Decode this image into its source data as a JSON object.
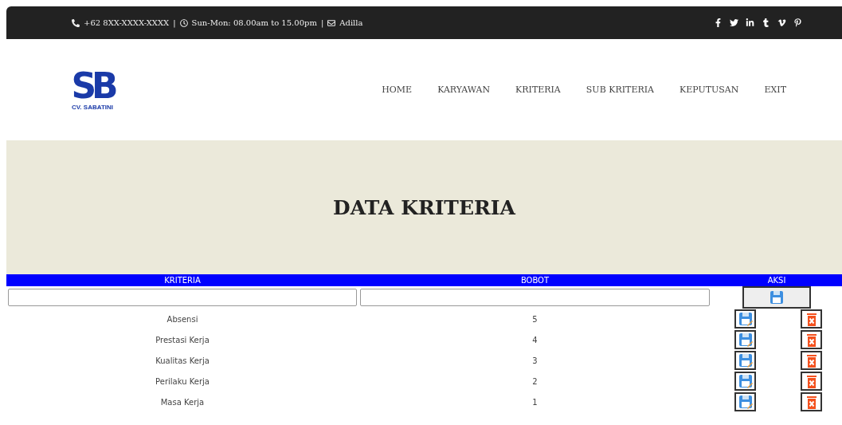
{
  "topbar": {
    "phone": "+62 8XX-XXXX-XXXX",
    "separator_1": "|",
    "hours": "Sun-Mon: 08.00am to 15.00pm",
    "separator_2": "|",
    "email": "Adilla",
    "social": [
      {
        "kind": "facebook"
      },
      {
        "kind": "twitter"
      },
      {
        "kind": "linkedin"
      },
      {
        "kind": "tumblr"
      },
      {
        "kind": "vimeo"
      },
      {
        "kind": "pinterest"
      }
    ]
  },
  "logo": {
    "mark": "SB",
    "company": "CV. SABATINI"
  },
  "nav": [
    {
      "label": "HOME"
    },
    {
      "label": "KARYAWAN"
    },
    {
      "label": "KRITERIA"
    },
    {
      "label": "SUB KRITERIA"
    },
    {
      "label": "KEPUTUSAN"
    },
    {
      "label": "EXIT"
    }
  ],
  "hero": {
    "title": "DATA KRITERIA"
  },
  "table": {
    "columns": [
      "KRITERIA",
      "BOBOT",
      "AKSI"
    ],
    "rows": [
      {
        "kriteria": "Absensi",
        "bobot": "5"
      },
      {
        "kriteria": "Prestasi Kerja",
        "bobot": "4"
      },
      {
        "kriteria": "Kualitas Kerja",
        "bobot": "3"
      },
      {
        "kriteria": "Perilaku Kerja",
        "bobot": "2"
      },
      {
        "kriteria": "Masa Kerja",
        "bobot": "1"
      }
    ]
  }
}
